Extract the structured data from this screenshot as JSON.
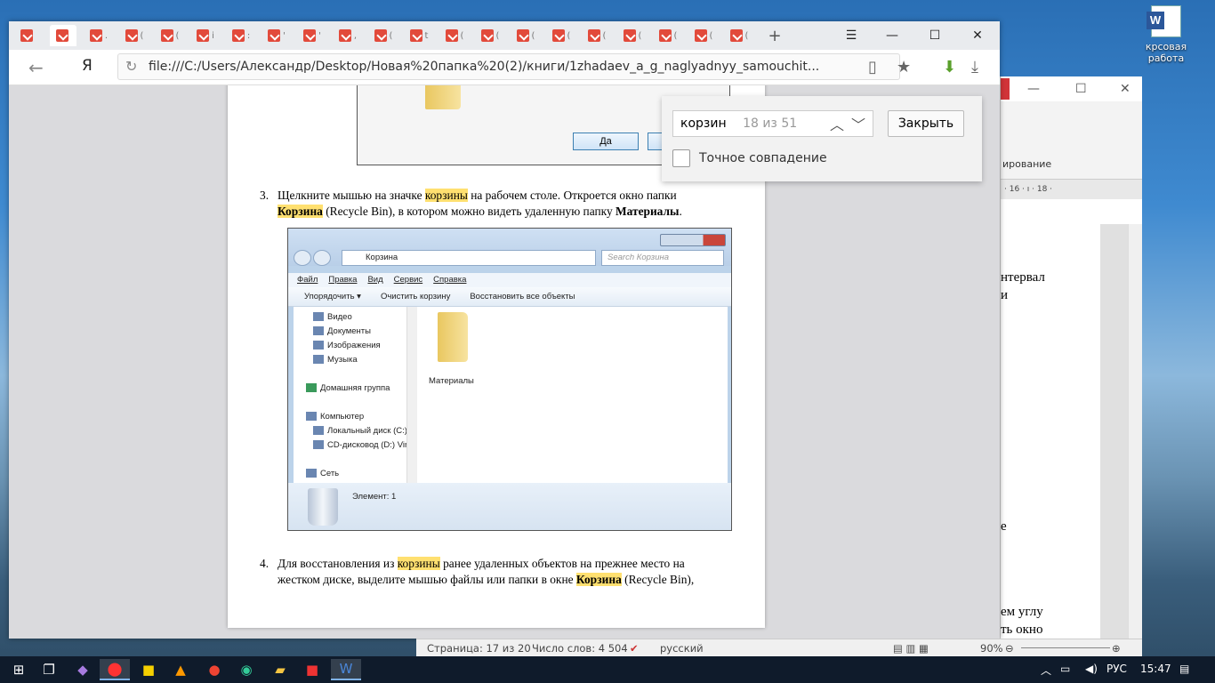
{
  "desktop": {
    "icon_label": "крсовая работа"
  },
  "browser": {
    "tabs": [
      {
        "suffix": ""
      },
      {
        "suffix": "",
        "active": true
      },
      {
        "suffix": "."
      },
      {
        "suffix": "("
      },
      {
        "suffix": "("
      },
      {
        "suffix": "i"
      },
      {
        "suffix": ":"
      },
      {
        "suffix": "'"
      },
      {
        "suffix": "'"
      },
      {
        "suffix": ","
      },
      {
        "suffix": "("
      },
      {
        "suffix": "t"
      },
      {
        "suffix": "("
      },
      {
        "suffix": "("
      },
      {
        "suffix": "("
      },
      {
        "suffix": "("
      },
      {
        "suffix": "("
      },
      {
        "suffix": "("
      },
      {
        "suffix": "("
      },
      {
        "suffix": "("
      },
      {
        "suffix": "("
      }
    ],
    "url": "file:///C:/Users/Александр/Desktop/Новая%20папка%20(2)/книги/1zhadaev_a_g_naglyadnyy_samouchit...",
    "yandex_letter": "Я",
    "new_tab": "+",
    "window": {
      "menu": "☰",
      "minimize": "—",
      "maximize": "☐",
      "close": "✕"
    }
  },
  "findbar": {
    "query": "корзин",
    "count": "18 из 51",
    "close_label": "Закрыть",
    "exact_label": "Точное совпадение"
  },
  "pdf": {
    "dialog_yes": "Да",
    "step3": {
      "num": "3.",
      "a1": "Щелкните мышью на значке ",
      "h1": "корзины",
      "a2": " на рабочем столе. Откроется окно папки",
      "h2": "Корзина",
      "b1": " (Recycle Bin), в котором можно видеть удаленную папку ",
      "bold": "Материалы",
      "b2": "."
    },
    "step4": {
      "num": "4.",
      "a1": "Для восстановления из ",
      "h1": "корзины",
      "a2": " ранее удаленных объектов на прежнее место на",
      "b1": "жестком диске, выделите мышью файлы или папки в окне ",
      "h2": "Корзина",
      "b2": " (Recycle Bin),"
    },
    "explorer": {
      "breadcrumb": "Корзина",
      "search": "Search Корзина",
      "menu": [
        "Файл",
        "Правка",
        "Вид",
        "Сервис",
        "Справка"
      ],
      "commands": [
        "Упорядочить ▾",
        "Очистить корзину",
        "Восстановить все объекты"
      ],
      "tree": [
        "Видео",
        "Документы",
        "Изображения",
        "Музыка",
        "Домашняя группа",
        "Компьютер",
        "Локальный диск (C:)",
        "CD-дисковод (D:) Virt",
        "Сеть"
      ],
      "folder": "Материалы",
      "status": "Элемент: 1"
    }
  },
  "word": {
    "ribbon_label": "ирование",
    "ruler": "· 16 · ı · 18 ·",
    "lines": [
      "нтервал",
      "и",
      "е",
      "ем углу",
      "ть окно"
    ],
    "status": {
      "page": "Страница: 17 из 20",
      "words": "Число слов: 4 504",
      "lang": "русский",
      "zoom": "90%"
    }
  },
  "taskbar": {
    "lang": "РУС",
    "time": "15:47"
  }
}
